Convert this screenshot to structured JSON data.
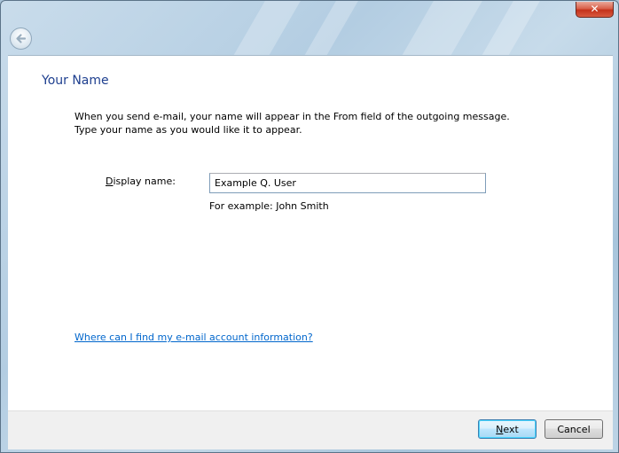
{
  "window": {
    "close_label": "✕",
    "back_label": "Back"
  },
  "page": {
    "title": "Your Name",
    "description_line1": "When you send e-mail, your name will appear in the From field of the outgoing message.",
    "description_line2": "Type your name as you would like it to appear."
  },
  "form": {
    "display_name_mnemonic": "D",
    "display_name_label_rest": "isplay name:",
    "display_name_value": "Example Q. User",
    "example_hint": "For example: John Smith"
  },
  "help_link": "Where can I find my e-mail account information?",
  "buttons": {
    "next_mnemonic": "N",
    "next_rest": "ext",
    "cancel_label": "Cancel"
  },
  "colors": {
    "title": "#1e3f8f",
    "link": "#0066cc",
    "content_bg": "#ffffff",
    "footer_bg": "#f0f0f0"
  },
  "icons": {
    "back": "back-arrow-icon",
    "close": "close-icon"
  }
}
